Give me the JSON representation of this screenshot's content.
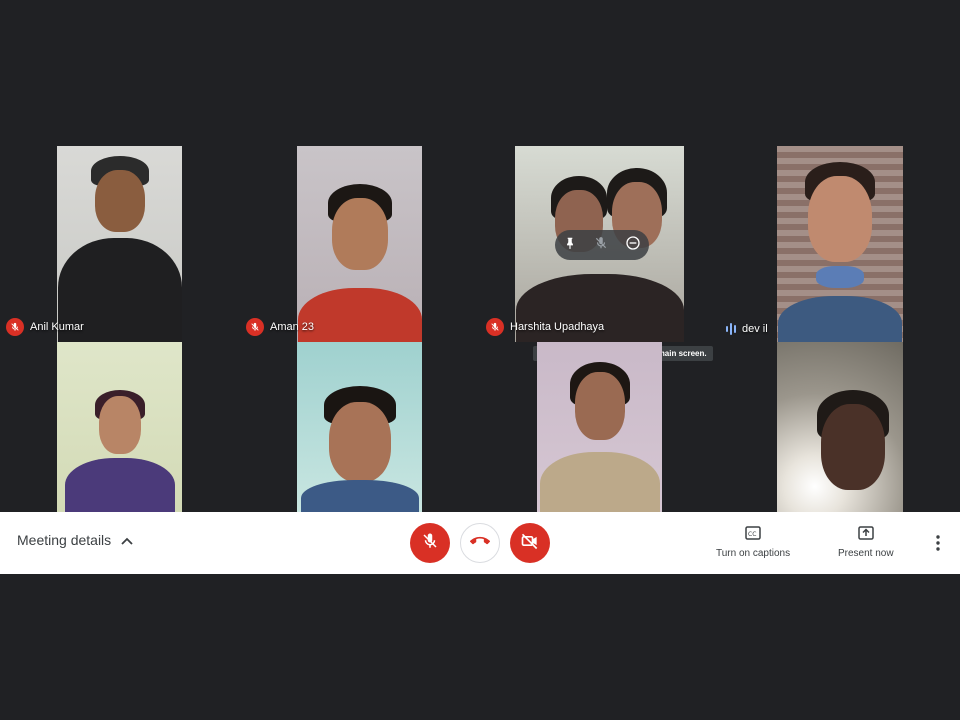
{
  "participants": [
    {
      "name": "Anil Kumar",
      "status": "muted"
    },
    {
      "name": "Aman 23",
      "status": "muted"
    },
    {
      "name": "Harshita Upadhaya",
      "status": "muted"
    },
    {
      "name": "dev il",
      "status": "speaking"
    },
    {
      "name": "",
      "status": "none"
    },
    {
      "name": "",
      "status": "none"
    },
    {
      "name": "",
      "status": "none"
    },
    {
      "name": "",
      "status": "none"
    }
  ],
  "hover": {
    "tooltip": "Pin Harshita Upadhaya to your main screen.",
    "icons": [
      "pin-icon",
      "mic-off-icon",
      "remove-icon"
    ]
  },
  "bottom_bar": {
    "meeting_details_label": "Meeting details",
    "captions_label": "Turn on captions",
    "present_label": "Present now"
  },
  "colors": {
    "background": "#202124",
    "danger": "#d93025",
    "speaking": "#8ab4f8",
    "bar": "#ffffff"
  }
}
